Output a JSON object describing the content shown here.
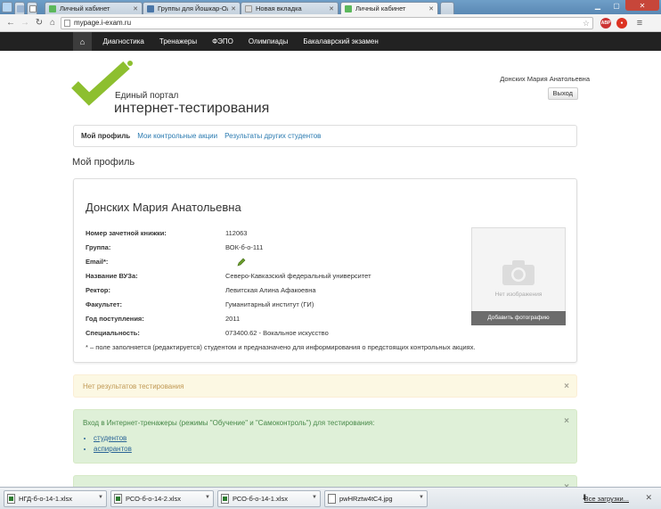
{
  "browser": {
    "tabs": [
      {
        "label": "Личный кабинет",
        "favicon_color": "#5cb85c",
        "active": false
      },
      {
        "label": "Группы для Йошкар-Ола",
        "favicon_color": "#4a76a8",
        "active": false
      },
      {
        "label": "Новая вкладка",
        "favicon_color": "#cccccc",
        "active": false
      },
      {
        "label": "Личный кабинет",
        "favicon_color": "#5cb85c",
        "active": true
      }
    ],
    "url": "mypage.i-exam.ru"
  },
  "site_nav": {
    "items": [
      "Диагностика",
      "Тренажеры",
      "ФЭПО",
      "Олимпиады",
      "Бакалаврский экзамен"
    ]
  },
  "header": {
    "logo_line1": "Единый портал",
    "logo_line2": "интернет-тестирования",
    "user_name": "Донских Мария Анатольевна",
    "logout_label": "Выход",
    "brand_color": "#8dbf2f"
  },
  "subtabs": [
    "Мой профиль",
    "Мои контрольные акции",
    "Результаты других студентов"
  ],
  "page_title": "Мой профиль",
  "profile": {
    "full_name": "Донских Мария Анатольевна",
    "fields": [
      {
        "label": "Номер зачетной книжки:",
        "value": "112063"
      },
      {
        "label": "Группа:",
        "value": "ВОК-б-о-111"
      },
      {
        "label": "Email*:",
        "value": ""
      },
      {
        "label": "Название ВУЗа:",
        "value": "Северо-Кавказский федеральный университет"
      },
      {
        "label": "Ректор:",
        "value": "Левитская Алина Афакоевна"
      },
      {
        "label": "Факультет:",
        "value": "Гуманитарный институт (ГИ)"
      },
      {
        "label": "Год поступления:",
        "value": "2011"
      },
      {
        "label": "Специальность:",
        "value": "073400.62 - Вокальное искусство"
      }
    ],
    "note": "* – поле заполняется (редактируется) студентом и предназначено для информирования о предстоящих контрольных акциях.",
    "photo_placeholder": "Нет изображения",
    "add_photo_label": "Добавить фотографию"
  },
  "alerts": {
    "no_results": "Нет результатов тестирования",
    "trainers_text": "Вход в Интернет-тренажеры (режимы \"Обучение\" и \"Самоконтроль\") для тестирования:",
    "trainer_links": [
      "студентов",
      "аспирантов"
    ],
    "close_glyph": "×"
  },
  "downloads": {
    "files": [
      "НГД-б-о-14-1.xlsx",
      "РСО-б-о-14-2.xlsx",
      "РСО-б-о-14-1.xlsx",
      "pwHRztw4tC4.jpg"
    ],
    "show_all_label": "Все загрузки..."
  }
}
